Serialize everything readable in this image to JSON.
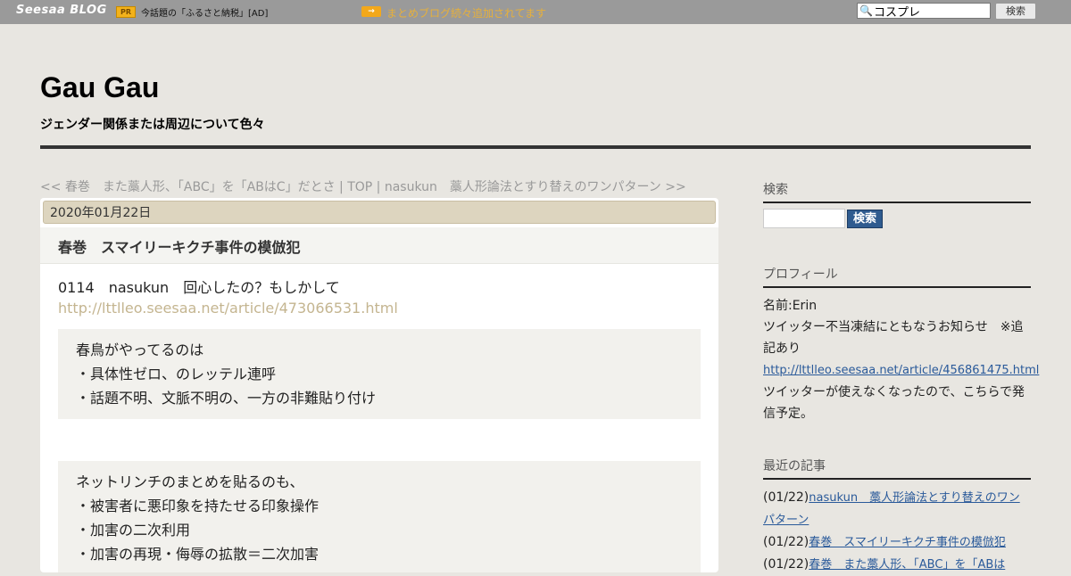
{
  "topbar": {
    "logo": "Seesaa BLOG",
    "pr_badge": "PR",
    "pr_text": "今話題の「ふるさと納税」[AD]",
    "matome_icon": "→",
    "matome_link": "まとめブログ続々追加されてます",
    "search_value": "コスプレ",
    "search_button": "検索",
    "icon": "search-icon"
  },
  "header": {
    "title": "Gau Gau",
    "description": "ジェンダー関係または周辺について色々"
  },
  "nav": {
    "prev": "<< 春巻　また藁人形、「ABC」を「ABはC」だとさ",
    "sep1": " | ",
    "top": "TOP",
    "sep2": " | ",
    "next": "nasukun　藁人形論法とすり替えのワンパターン >>"
  },
  "post": {
    "date": "2020年01月22日",
    "title": "春巻　スマイリーキクチ事件の模倣犯",
    "line1": "0114　nasukun　回心したの？もしかして",
    "link1": "http://lttlleo.seesaa.net/article/473066531.html",
    "quote1": [
      "春鳥がやってるのは",
      "・具体性ゼロ、のレッテル連呼",
      "・話題不明、文脈不明の、一方の非難貼り付け"
    ],
    "quote2": [
      "ネットリンチのまとめを貼るのも、",
      "・被害者に悪印象を持たせる印象操作",
      "・加害の二次利用",
      "・加害の再現・侮辱の拡散＝二次加害"
    ]
  },
  "sidebar": {
    "search_heading": "検索",
    "search_button": "検索",
    "profile_heading": "プロフィール",
    "profile_name": "名前:Erin",
    "profile_notice": "ツイッター不当凍結にともなうお知らせ　※追記あり",
    "profile_link": "http://lttlleo.seesaa.net/article/456861475.html",
    "profile_note": "ツイッターが使えなくなったので、こちらで発信予定。",
    "recent_heading": "最近の記事",
    "recent": [
      {
        "date": "(01/22)",
        "title": "nasukun　藁人形論法とすり替えのワンパターン"
      },
      {
        "date": "(01/22)",
        "title": "春巻　スマイリーキクチ事件の模倣犯"
      },
      {
        "date": "(01/22)",
        "title": "春巻　また藁人形、「ABC」を「ABは"
      }
    ]
  }
}
